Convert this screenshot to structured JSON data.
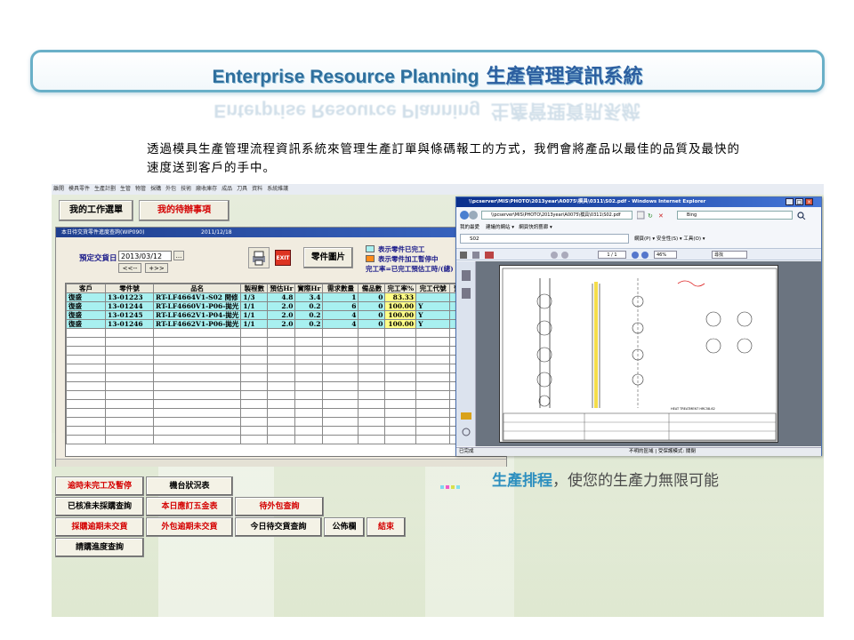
{
  "banner": {
    "title_en": "Enterprise Resource Planning",
    "title_zh": "生產管理資訊系統"
  },
  "intro": "透過模具生產管理流程資訊系統來管理生產訂單與條碼報工的方式，我們會將產品以最佳的品質及最快的速度送到客戶的手中。",
  "menu_items": [
    "離開",
    "模具零件",
    "生產計劃",
    "生管",
    "物管",
    "採購",
    "外包",
    "技術",
    "廠收庫存",
    "成品",
    "刀具",
    "資料",
    "系統維護"
  ],
  "top_buttons": {
    "my_work": "我的工作選單",
    "todo": "我的待辦事項"
  },
  "wip_window": {
    "title": "本日待交貨零件進度查詢(WIP090)",
    "date_title": "2011/12/18",
    "planned_date_label": "預定交貨日",
    "planned_date_value": "2013/03/12",
    "date_btn": "...",
    "prev_btn": "<<--",
    "next_btn": "+>>",
    "exit_label": "EXIT",
    "parts_image_btn": "零件圖片",
    "legend": [
      {
        "text": "表示零件已完工",
        "color": "#a8f0f0"
      },
      {
        "text": "表示零件加工暫停中",
        "color": "#ff8c1a"
      }
    ],
    "legend_note": "完工率=已完工預估工時/(總)",
    "columns": [
      "客戶",
      "零件號",
      "品名",
      "製程數",
      "預估Hr",
      "實際Hr",
      "需求數量",
      "備品數",
      "完工率%",
      "完工代號",
      "預完"
    ],
    "rows": [
      [
        "復盛",
        "13-01223",
        "RT-LF4664V1-S02 開修",
        "1/3",
        "4.8",
        "3.4",
        "1",
        "0",
        "83.33",
        "",
        ""
      ],
      [
        "復盛",
        "13-01244",
        "RT-LF4660V1-P06-拋光",
        "1/1",
        "2.0",
        "0.2",
        "6",
        "0",
        "100.00",
        "Y",
        ""
      ],
      [
        "復盛",
        "13-01245",
        "RT-LF4662V1-P04-拋光",
        "1/1",
        "2.0",
        "0.2",
        "4",
        "0",
        "100.00",
        "Y",
        ""
      ],
      [
        "復盛",
        "13-01246",
        "RT-LF4662V1-P06-拋光",
        "1/1",
        "2.0",
        "0.2",
        "4",
        "0",
        "100.00",
        "Y",
        ""
      ]
    ]
  },
  "ie_window": {
    "title": "\\\\pcserver\\MIS\\PHOTO\\2013year\\A0075\\模具\\0311\\S02.pdf - Windows Internet Explorer",
    "address": "\\\\pcserver\\MIS\\PHOTO\\2013year\\A0075\\模具\\0311\\S02.pdf",
    "search_placeholder": "Bing",
    "favorites": "我的最愛",
    "suggested_sites": "建議的網站 ▾",
    "web_slice": "網頁快訊藝廊 ▾",
    "tab_label": "S02",
    "commands": "網頁(P) ▾  安全性(S) ▾  工具(O) ▾",
    "page_value": "1",
    "page_total": "/ 1",
    "zoom": "46%",
    "find": "尋找",
    "status_done": "已完成",
    "status_zone": "不明的區域 | 受保護模式: 關閉",
    "drawing_note": "HEAT TREATMENT HRC58-62"
  },
  "bottom_buttons": {
    "overdue_suspended": "逾時未完工及暫停",
    "machine_status": "機台狀況表",
    "approved_not_purchased": "已核准未採購查詢",
    "today_hardware": "本日應訂五金表",
    "outsource_query": "待外包查詢",
    "purchase_overdue": "採購逾期未交貨",
    "outsource_overdue": "外包逾期未交貨",
    "today_delivery": "今日待交貨查詢",
    "bulletin": "公佈欄",
    "close": "結束",
    "request_progress": "請購進度查詢"
  },
  "tagline": {
    "highlight": "生產排程",
    "rest": "，使您的生產力無限可能"
  },
  "colors": {
    "banner_border": "#6ab0c8",
    "done_row": "#a8f0f0",
    "rate_cell": "#ffff88",
    "accent": "#2d8fbf"
  }
}
